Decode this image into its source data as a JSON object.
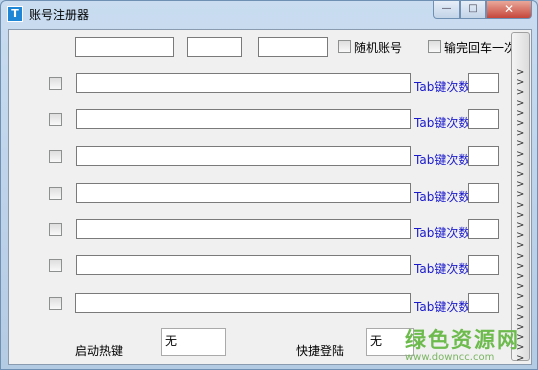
{
  "window": {
    "title": "账号注册器",
    "icon_glyph": "T"
  },
  "controls": {
    "minimize": "—",
    "maximize": "□",
    "close": "✕"
  },
  "top_row": {
    "random_account_label": "随机账号",
    "enter_once_label": "输完回车一次"
  },
  "rows": [
    {
      "tab_label": "Tab键次数"
    },
    {
      "tab_label": "Tab键次数"
    },
    {
      "tab_label": "Tab键次数"
    },
    {
      "tab_label": "Tab键次数"
    },
    {
      "tab_label": "Tab键次数"
    },
    {
      "tab_label": "Tab键次数"
    },
    {
      "tab_label": "Tab键次数"
    }
  ],
  "arrows": [
    ">",
    ">",
    ">",
    ">",
    ">",
    ">",
    ">",
    ">",
    ">",
    ">",
    ">",
    ">",
    ">",
    ">",
    ">",
    ">",
    ">",
    ">",
    ">",
    ">",
    ">",
    ">",
    ">",
    ">",
    ">",
    ">",
    ">",
    ">",
    ">"
  ],
  "bottom": {
    "start_hotkey_label": "启动热键",
    "start_hotkey_value": "无",
    "quick_login_label": "快捷登陆",
    "quick_login_value": "无"
  },
  "watermark": {
    "title": "绿色资源网",
    "url": "www.downcc.com"
  }
}
